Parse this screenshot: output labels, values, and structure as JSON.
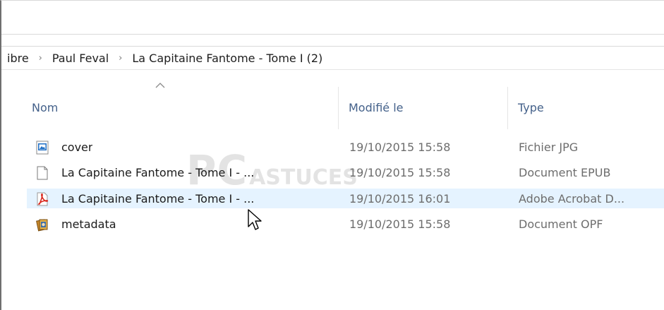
{
  "breadcrumb": [
    {
      "label": "ibre"
    },
    {
      "label": "Paul Feval"
    },
    {
      "label": "La Capitaine Fantome - Tome I (2)"
    }
  ],
  "breadcrumb_separator": "›",
  "columns": {
    "name": "Nom",
    "modified": "Modifié le",
    "type": "Type",
    "sort": "ascending"
  },
  "files": [
    {
      "name": "cover",
      "modified": "19/10/2015 15:58",
      "type": "Fichier JPG",
      "icon": "image-file-icon"
    },
    {
      "name": "La Capitaine Fantome - Tome I - ...",
      "modified": "19/10/2015 15:58",
      "type": "Document EPUB",
      "icon": "blank-document-icon"
    },
    {
      "name": "La Capitaine Fantome - Tome I - ...",
      "modified": "19/10/2015 16:01",
      "type": "Adobe Acrobat D...",
      "icon": "pdf-file-icon",
      "hovered": true
    },
    {
      "name": "metadata",
      "modified": "19/10/2015 15:58",
      "type": "Document OPF",
      "icon": "opf-file-icon"
    }
  ],
  "watermark": {
    "part1": "PC",
    "part2": "ASTUCES"
  },
  "colors": {
    "header_text": "#44618a",
    "hover_row": "#e5f3ff",
    "pdf_red": "#d9261c",
    "jpg_blue": "#1f6fc5"
  }
}
